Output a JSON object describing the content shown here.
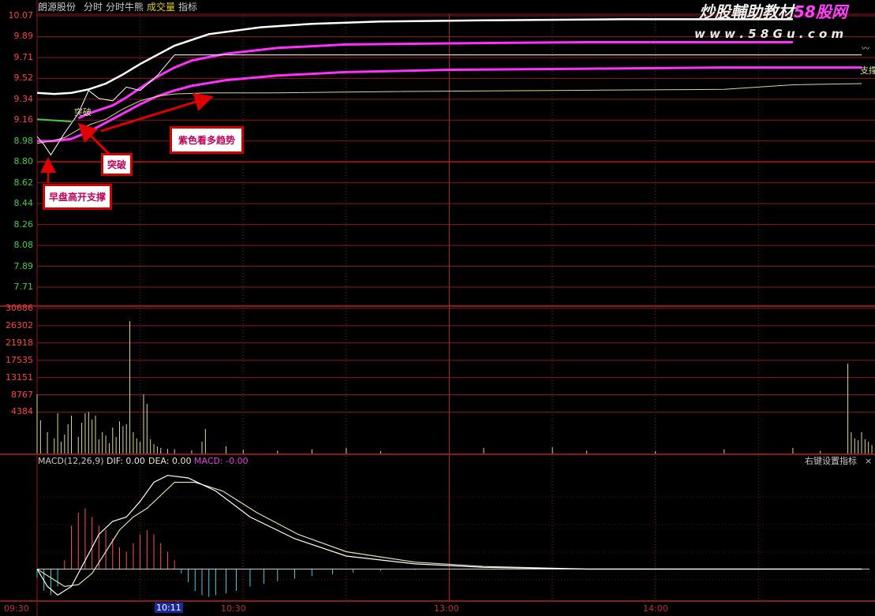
{
  "header": {
    "stock_name": "朗源股份",
    "tab_timeshare": "分时",
    "tab_bull": "分时牛熊",
    "tab_volume": "成交量",
    "tab_indicator": "指标"
  },
  "watermark": {
    "line1": "炒股輔助教材",
    "line2_brand": "58股网",
    "url": "w w w . 5 8 G u . c o m"
  },
  "price_axis": [
    "10.07",
    "9.89",
    "9.71",
    "9.52",
    "9.34",
    "9.16",
    "8.98",
    "8.80",
    "8.62",
    "8.44",
    "8.26",
    "8.08",
    "7.89",
    "7.71"
  ],
  "volume_axis": [
    "30686",
    "26302",
    "21918",
    "17535",
    "13151",
    "8767",
    "4384"
  ],
  "time_axis": {
    "start": "09:30",
    "cursor": "10:11",
    "t1030": "10:30",
    "t1300": "13:00",
    "t1400": "14:00"
  },
  "macd_header": {
    "name": "MACD(12,26,9)",
    "dif": "DIF: 0.00",
    "dea": "DEA: 0.00",
    "macd": "MACD: -0.00",
    "settings": "右键设置指标",
    "close": "×"
  },
  "chart_labels": {
    "breakout": "突破",
    "support": "支撑"
  },
  "annotations": {
    "breakout": "突破",
    "purple_trend": "紫色看多趋势",
    "open_support": "早盘高开支撑"
  },
  "colors": {
    "grid": "#8a1a1a",
    "axis_price": "#ff4040",
    "price_line": "#ffffff",
    "avg_line": "#d8d890",
    "pink_line": "#ff30ff",
    "green_line": "#40d040",
    "volume_bar": "#e0d890",
    "macd_up": "#ff5050",
    "macd_down": "#40d0e0",
    "annotation_border": "#d00000",
    "annotation_text": "#c0005a"
  },
  "chart_data": {
    "type": "line",
    "price_ylim": [
      7.71,
      10.07
    ],
    "volume_ylim": [
      0,
      30686
    ],
    "price_series": {
      "x_min": [
        0,
        2,
        4,
        8,
        12,
        15,
        18,
        22,
        26,
        30,
        35,
        40,
        45,
        55,
        65,
        80,
        95,
        115,
        140,
        170,
        200,
        240
      ],
      "y": [
        9.02,
        8.95,
        8.86,
        9.05,
        9.22,
        9.42,
        9.35,
        9.33,
        9.45,
        9.42,
        9.55,
        9.73,
        9.73,
        9.73,
        9.73,
        9.73,
        9.73,
        9.73,
        9.73,
        9.73,
        9.73,
        9.73
      ]
    },
    "avg_series": {
      "x_min": [
        0,
        4,
        8,
        12,
        16,
        20,
        25,
        30,
        35,
        40,
        50,
        70,
        100,
        150,
        200,
        220,
        240
      ],
      "y": [
        8.96,
        8.98,
        9.01,
        9.08,
        9.13,
        9.17,
        9.26,
        9.33,
        9.37,
        9.39,
        9.4,
        9.4,
        9.41,
        9.42,
        9.43,
        9.47,
        9.48
      ]
    },
    "white_curve": {
      "x_min": [
        0,
        5,
        10,
        15,
        20,
        25,
        30,
        40,
        50,
        65,
        80,
        100,
        130,
        170,
        200,
        220
      ],
      "y": [
        9.4,
        9.39,
        9.4,
        9.43,
        9.48,
        9.56,
        9.65,
        9.81,
        9.91,
        9.97,
        10.0,
        10.02,
        10.03,
        10.04,
        10.04,
        10.04
      ]
    },
    "pink_upper": {
      "x_min": [
        12,
        15,
        18,
        22,
        26,
        30,
        35,
        40,
        45,
        55,
        70,
        90,
        120,
        160,
        200,
        220
      ],
      "y": [
        9.18,
        9.22,
        9.25,
        9.29,
        9.36,
        9.44,
        9.54,
        9.62,
        9.68,
        9.74,
        9.79,
        9.82,
        9.83,
        9.84,
        9.84,
        9.84
      ]
    },
    "pink_lower": {
      "x_min": [
        0,
        5,
        10,
        15,
        20,
        25,
        30,
        35,
        40,
        45,
        55,
        70,
        90,
        120,
        160,
        200,
        240
      ],
      "y": [
        8.98,
        8.98,
        9.0,
        9.06,
        9.14,
        9.22,
        9.3,
        9.37,
        9.42,
        9.46,
        9.51,
        9.55,
        9.58,
        9.6,
        9.61,
        9.62,
        9.62
      ]
    },
    "green_segment": {
      "x_min": [
        0,
        5,
        10
      ],
      "y": [
        9.17,
        9.16,
        9.15
      ]
    },
    "volume": [
      [
        0,
        12500
      ],
      [
        1,
        7000
      ],
      [
        3,
        4500
      ],
      [
        5,
        3200
      ],
      [
        6,
        8500
      ],
      [
        7,
        2500
      ],
      [
        8,
        4000
      ],
      [
        9,
        6200
      ],
      [
        10,
        8000
      ],
      [
        12,
        3500
      ],
      [
        13,
        6500
      ],
      [
        14,
        8500
      ],
      [
        15,
        8800
      ],
      [
        16,
        7200
      ],
      [
        17,
        8000
      ],
      [
        18,
        3000
      ],
      [
        19,
        4500
      ],
      [
        20,
        3800
      ],
      [
        21,
        2200
      ],
      [
        22,
        5500
      ],
      [
        23,
        3500
      ],
      [
        24,
        6800
      ],
      [
        25,
        5800
      ],
      [
        26,
        6200
      ],
      [
        27,
        28000
      ],
      [
        28,
        4500
      ],
      [
        29,
        3200
      ],
      [
        30,
        2500
      ],
      [
        31,
        12500
      ],
      [
        32,
        10500
      ],
      [
        33,
        3000
      ],
      [
        34,
        2000
      ],
      [
        35,
        1500
      ],
      [
        36,
        1200
      ],
      [
        38,
        1000
      ],
      [
        40,
        900
      ],
      [
        45,
        700
      ],
      [
        48,
        2500
      ],
      [
        49,
        5200
      ],
      [
        55,
        1500
      ],
      [
        60,
        800
      ],
      [
        70,
        600
      ],
      [
        80,
        900
      ],
      [
        90,
        1200
      ],
      [
        100,
        500
      ],
      [
        130,
        1200
      ],
      [
        150,
        1300
      ],
      [
        160,
        600
      ],
      [
        180,
        500
      ],
      [
        200,
        900
      ],
      [
        220,
        1200
      ],
      [
        228,
        600
      ],
      [
        236,
        19000
      ],
      [
        237,
        4500
      ],
      [
        238,
        3200
      ],
      [
        239,
        2800
      ],
      [
        240,
        4500
      ],
      [
        241,
        3000
      ],
      [
        242,
        2500
      ],
      [
        243,
        1800
      ],
      [
        244,
        1200
      ]
    ],
    "macd": {
      "ylim": [
        -0.035,
        0.115
      ],
      "dif": {
        "x_min": [
          0,
          3,
          6,
          10,
          14,
          18,
          22,
          26,
          30,
          34,
          38,
          44,
          52,
          62,
          75,
          90,
          110,
          130,
          160,
          200,
          240
        ],
        "y": [
          0.0,
          -0.02,
          -0.03,
          -0.02,
          0.01,
          0.04,
          0.055,
          0.06,
          0.078,
          0.1,
          0.108,
          0.105,
          0.09,
          0.06,
          0.035,
          0.015,
          0.006,
          0.002,
          0.0,
          0.0,
          0.0
        ]
      },
      "dea": {
        "x_min": [
          0,
          4,
          8,
          12,
          16,
          20,
          24,
          28,
          32,
          36,
          40,
          46,
          54,
          64,
          76,
          90,
          110,
          130,
          160,
          200,
          240
        ],
        "y": [
          0.0,
          -0.01,
          -0.02,
          -0.018,
          -0.005,
          0.02,
          0.045,
          0.06,
          0.07,
          0.085,
          0.1,
          0.1,
          0.09,
          0.065,
          0.04,
          0.02,
          0.008,
          0.003,
          0.0,
          0.0,
          0.0
        ]
      },
      "hist": [
        [
          0,
          -0.01
        ],
        [
          2,
          -0.025
        ],
        [
          4,
          -0.03
        ],
        [
          6,
          -0.02
        ],
        [
          8,
          0.01
        ],
        [
          10,
          0.05
        ],
        [
          12,
          0.065
        ],
        [
          14,
          0.07
        ],
        [
          16,
          0.06
        ],
        [
          18,
          0.05
        ],
        [
          20,
          0.045
        ],
        [
          22,
          0.035
        ],
        [
          24,
          0.025
        ],
        [
          26,
          0.02
        ],
        [
          28,
          0.03
        ],
        [
          30,
          0.04
        ],
        [
          32,
          0.045
        ],
        [
          34,
          0.04
        ],
        [
          36,
          0.03
        ],
        [
          38,
          0.02
        ],
        [
          40,
          0.01
        ],
        [
          42,
          -0.005
        ],
        [
          44,
          -0.015
        ],
        [
          46,
          -0.025
        ],
        [
          48,
          -0.03
        ],
        [
          50,
          -0.032
        ],
        [
          52,
          -0.03
        ],
        [
          55,
          -0.028
        ],
        [
          58,
          -0.025
        ],
        [
          62,
          -0.02
        ],
        [
          66,
          -0.017
        ],
        [
          70,
          -0.014
        ],
        [
          75,
          -0.011
        ],
        [
          80,
          -0.008
        ],
        [
          86,
          -0.006
        ],
        [
          92,
          -0.004
        ],
        [
          100,
          -0.002
        ],
        [
          110,
          -0.001
        ]
      ]
    }
  }
}
